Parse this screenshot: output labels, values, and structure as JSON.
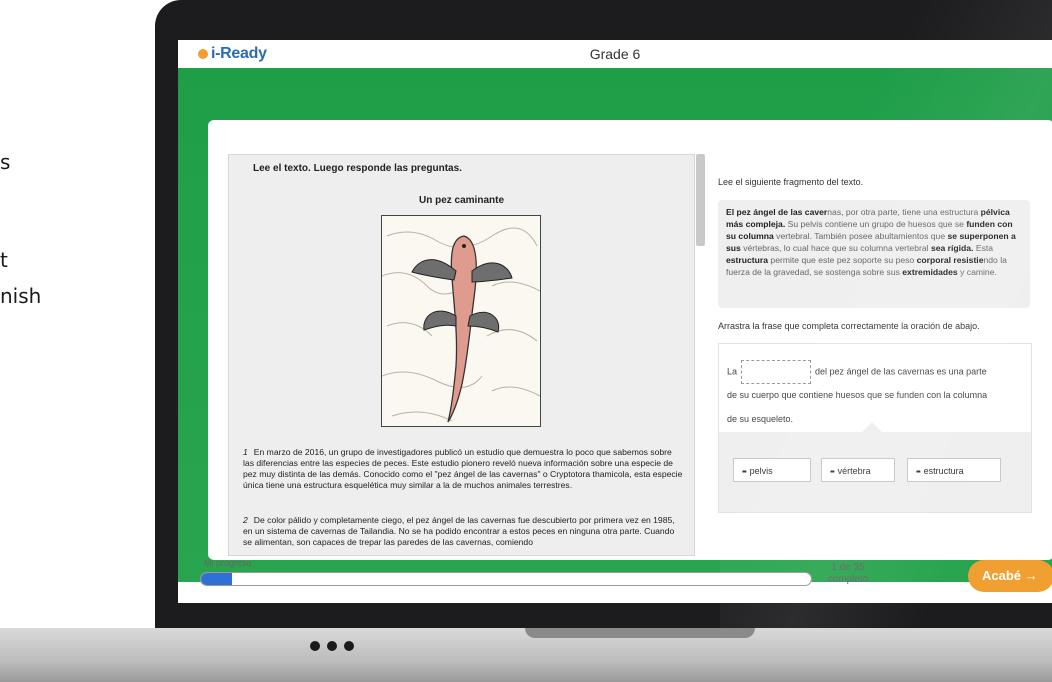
{
  "side_text": [
    "s",
    "t",
    "nish"
  ],
  "app": {
    "logo": "i-Ready",
    "grade": "Grade 6"
  },
  "passage": {
    "instruction": "Lee el texto. Luego responde las preguntas.",
    "title": "Un pez caminante",
    "paragraphs": [
      {
        "num": "1",
        "text": "En marzo de 2016, un grupo de investigadores publicó un estudio que demuestra lo poco que sabemos sobre las diferencias entre las especies de peces. Este estudio pionero reveló nueva información sobre una especie de pez muy distinta de las demás. Conocido como el \"pez ángel de las cavernas\" o Cryptotora thamicola, esta especie única tiene una estructura esquelética muy similar a la de muchos animales terrestres."
      },
      {
        "num": "2",
        "text": "De color pálido y completamente ciego, el pez ángel de las cavernas fue descubierto por primera vez en 1985, en un sistema de cavernas de Tailandia. No se ha podido encontrar a estos peces en ninguna otra parte. Cuando se alimentan, son capaces de trepar las paredes de las cavernas, comiendo"
      }
    ]
  },
  "question": {
    "lead": "Lee el siguiente fragmento del texto.",
    "excerpt_parts": [
      {
        "t": "El pez ángel de las caver",
        "b": true
      },
      {
        "t": "nas, por otra parte, tiene una estructura ",
        "b": false
      },
      {
        "t": "pélvica más compleja.",
        "b": true
      },
      {
        "t": " Su pelvis contiene un grupo de huesos que se ",
        "b": false
      },
      {
        "t": "funden con su columna",
        "b": true
      },
      {
        "t": " vertebral. También posee abultamientos que ",
        "b": false
      },
      {
        "t": "se superponen a sus",
        "b": true
      },
      {
        "t": " vértebras, lo cual hace que su columna vertebral ",
        "b": false
      },
      {
        "t": "sea rígida.",
        "b": true
      },
      {
        "t": " Esta ",
        "b": false
      },
      {
        "t": "estructura",
        "b": true
      },
      {
        "t": " permite que este pez soporte su peso ",
        "b": false
      },
      {
        "t": "corporal resistie",
        "b": true
      },
      {
        "t": "ndo la fuerza de la gravedad, se sostenga sobre sus ",
        "b": false
      },
      {
        "t": "extremidades",
        "b": true
      },
      {
        "t": " y camine.",
        "b": false
      }
    ],
    "drag_prompt": "Arrastra la frase que completa correctamente la oración de abajo.",
    "sentence_start": "La",
    "sentence_rest": "del pez ángel de las cavernas es una parte",
    "sentence_line2": "de su cuerpo que contiene huesos que se funden con la columna",
    "sentence_line3": "de su esqueleto.",
    "choices": [
      "pelvis",
      "vértebra",
      "estructura"
    ]
  },
  "progress": {
    "label": "Mi progreso",
    "count": "1 de 35",
    "status": "completo",
    "value": 1,
    "total": 35
  },
  "done_button": "Acabé →",
  "colors": {
    "brand_green": "#1f9e48",
    "accent_orange": "#f0a030",
    "progress_blue": "#2f6fd6"
  }
}
